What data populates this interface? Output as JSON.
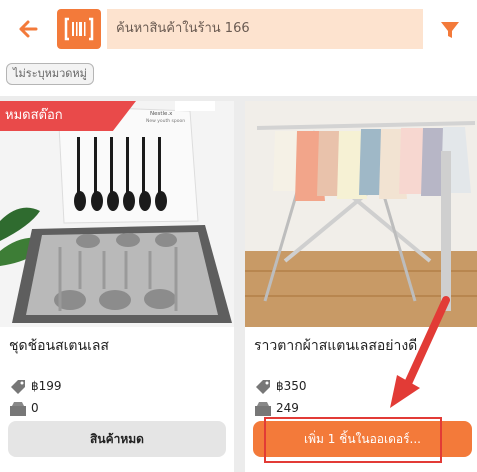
{
  "header": {
    "search_placeholder": "ค้นหาสินค้าในร้าน 166"
  },
  "filter_chip": "ไม่ระบุหมวดหมู่",
  "colors": {
    "accent": "#f37a3a",
    "sold_out": "#e94a4a",
    "highlight": "#e23b36"
  },
  "icons": {
    "back": "arrow-left-icon",
    "scan": "barcode-scan-icon",
    "filter": "filter-icon",
    "price": "price-tag-icon",
    "stock": "stock-box-icon"
  },
  "products": [
    {
      "badge": "หมดสต๊อก",
      "name": "ชุดช้อนสเตนเลส",
      "price": "฿199",
      "stock": "0",
      "button": "สินค้าหมด",
      "package_label": "Nestle.x",
      "package_sub": "New youth spoon"
    },
    {
      "name": "ราวตากผ้าสแตนเลสอย่างดี",
      "price": "฿350",
      "stock": "249",
      "button": "เพิ่ม 1 ชิ้นในออเดอร์..."
    }
  ]
}
